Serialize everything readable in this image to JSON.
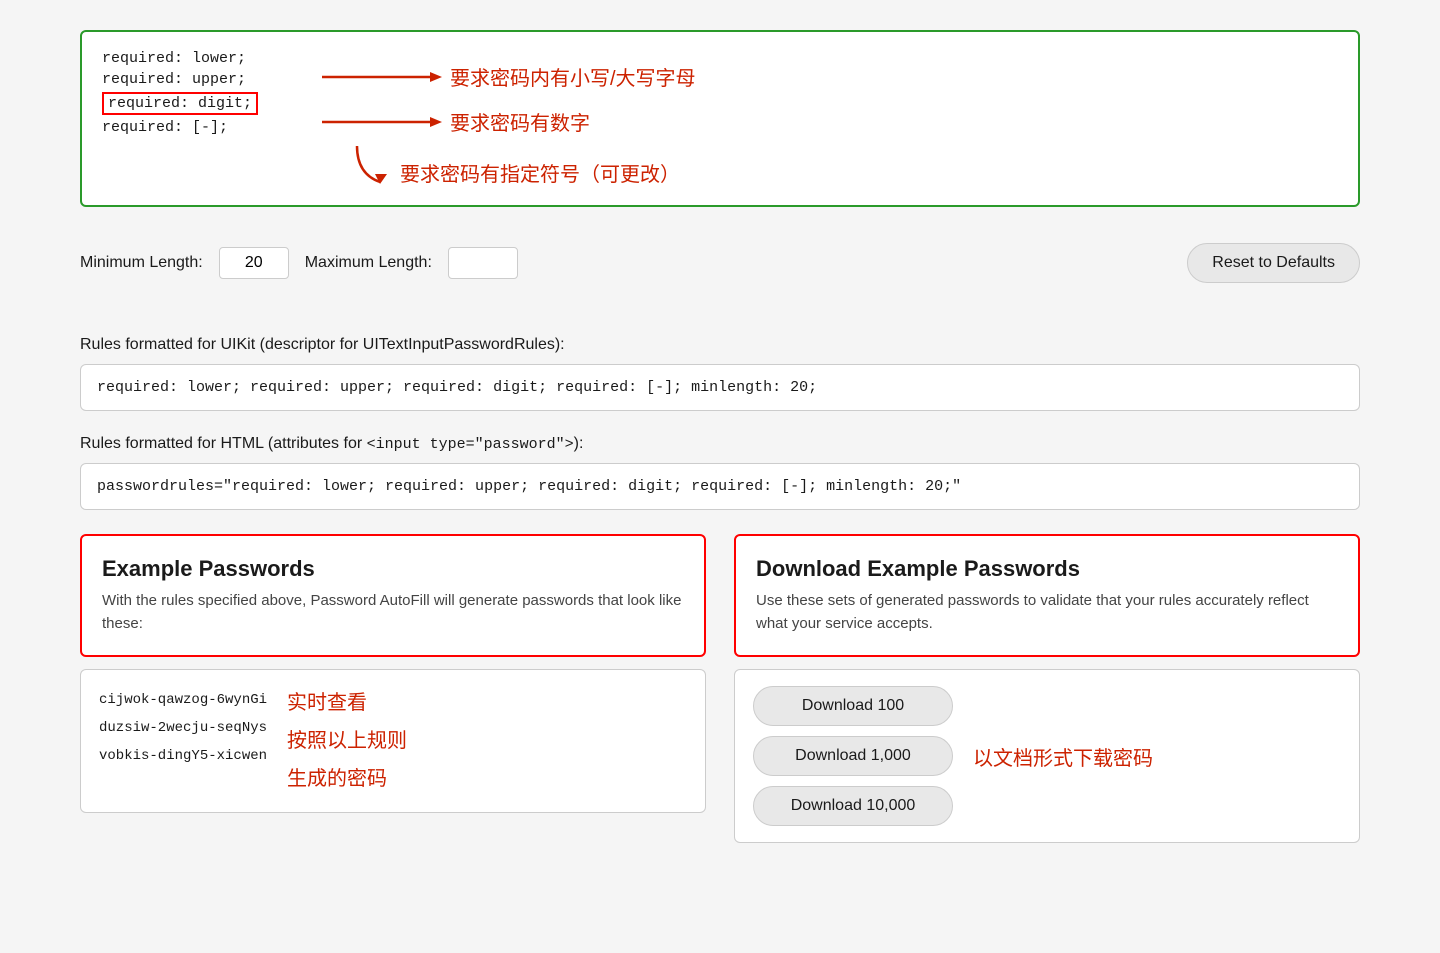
{
  "annotation": {
    "line1": "required: lower;",
    "line2": "required: upper;",
    "line3_boxed": "required: digit;",
    "line4": "required: [-];",
    "arrow1_label": "要求密码内有小写/大写字母",
    "arrow2_label": "要求密码有数字",
    "arrow3_label": "要求密码有指定符号（可更改）"
  },
  "length": {
    "min_label": "Minimum Length:",
    "min_value": "20",
    "max_label": "Maximum Length:",
    "max_value": "",
    "reset_label": "Reset to Defaults"
  },
  "uikit_section": {
    "description": "Rules formatted for UIKit (descriptor for UITextInputPasswordRules):",
    "output": "required: lower; required: upper; required: digit; required: [-]; minlength: 20;"
  },
  "html_section": {
    "description_prefix": "Rules formatted for HTML (attributes for ",
    "description_code": "<input type=\"password\">",
    "description_suffix": "):",
    "output": "passwordrules=\"required: lower; required: upper; required: digit; required: [-]; minlength: 20;\""
  },
  "example_passwords": {
    "title": "Example Passwords",
    "description": "With the rules specified above, Password AutoFill will generate passwords that look like these:",
    "passwords": [
      "cijwok-qawzog-6wynGi",
      "duzsiw-2wecju-seqNys",
      "vobkis-dingY5-xicwen"
    ],
    "chinese_lines": [
      "实时查看",
      "按照以上规则",
      "生成的密码"
    ]
  },
  "download_passwords": {
    "title": "Download Example Passwords",
    "description": "Use these sets of generated passwords to validate that your rules accurately reflect what your service accepts.",
    "buttons": [
      "Download 100",
      "Download 1,000",
      "Download 10,000"
    ],
    "chinese_label": "以文档形式下载密码"
  }
}
